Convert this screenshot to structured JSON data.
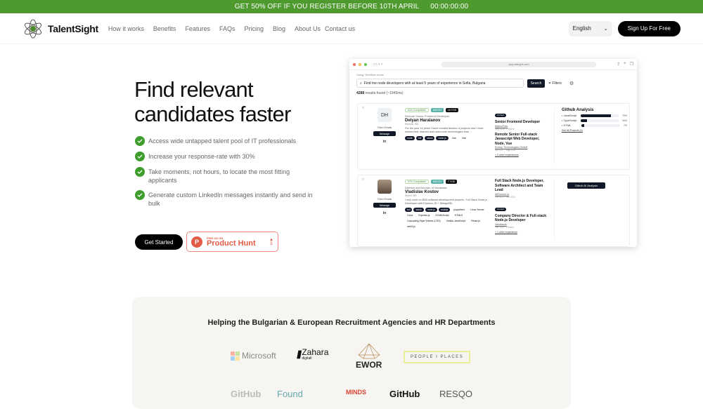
{
  "promo": {
    "text": "GET 50% OFF IF YOU REGISTER BEFORE 10TH APRIL",
    "countdown": "00:00:00:00",
    "color": "#4e9a2f"
  },
  "nav": {
    "brand": "TalentSight",
    "links": [
      "How it works",
      "Benefits",
      "Features",
      "FAQs",
      "Pricing",
      "Blog",
      "About Us",
      "Contact us"
    ],
    "language": "English",
    "signup": "Sign Up For Free"
  },
  "hero": {
    "title_line1": "Find relevant",
    "title_line2": "candidates faster",
    "features": [
      "Access wide untapped talent pool of IT professionals",
      "Increase your response-rate with 30%",
      "Take moments, not hours, to locate the most fitting applicants",
      "Generate custom LinkedIn messages instantly and send in bulk"
    ],
    "cta": "Get Started",
    "product_hunt": {
      "small": "FIND US ON",
      "big": "Product Hunt",
      "votes": "5"
    }
  },
  "browser": {
    "url": "app.talsight.com",
    "mode": "Using: Nextflow mode",
    "query": "Find me node developers with at least 5 years of experience in Sofia, Bulgaria",
    "search_btn": "Search",
    "filters": "Filters",
    "results_count": "4288",
    "results_text": "results found (~1945ms)",
    "candidates": [
      {
        "initials": "DH",
        "fetch": "Fetch Emails",
        "message": "Message",
        "compat": "81% Compatible",
        "match": "MATCH",
        "yoe": "16 YOE",
        "role": "Remote Senior Frontend Developer",
        "name": "Delyan Haralanov",
        "location": "Remote, BG",
        "bio": "For the past 14 years I have created dozens of projects and I have researched, learned and used more technologies than ...",
        "tags_dark": [
          "node",
          "full",
          "stack",
          "node.js"
        ],
        "tags_light": [
          "Vue",
          "Vite"
        ],
        "experience": [
          {
            "current": "Current",
            "title": "Senior Frontend Developer",
            "company": "MamoPoto",
            "dates": "Sep 2019 - Present"
          },
          {
            "current": "",
            "title": "Remote Senior Full-stack Javascript Web Developer, Node, Vue",
            "company": "Entrop Technologies GmbH",
            "dates": "Apr 2017 - Aug 2019"
          }
        ],
        "more": "+ 3 other experiences",
        "github": {
          "title": "Github Analysis",
          "langs": [
            {
              "name": "JavaScript",
              "pct": 79,
              "label": "79%"
            },
            {
              "name": "TypeScript",
              "pct": 16,
              "label": "16%"
            },
            {
              "name": "HTML",
              "pct": 7,
              "label": "7%"
            }
          ],
          "link": "See All Projects (4)"
        }
      },
      {
        "initials": "",
        "fetch": "Fetch Emails",
        "message": "Message",
        "compat": "57% Compatible",
        "match": "MATCH",
        "yoe": "7 YOE",
        "role": "Director and founder of Vavakada",
        "name": "Vladislav Kostov",
        "location": "Sliven, BG",
        "bio": "I only work on B2B software development projects. Full Stack Node.js Developer with Express.JS + MongoDB...",
        "tags_dark": [
          "full",
          "stack",
          "node.js",
          "nodejs"
        ],
        "tags_light": [
          "puppeteer",
          "Linux Server",
          "Linux",
          "Express.js",
          "ECMAScript",
          "HTML5",
          "Cascading Style Sheets (CSS)",
          "Vanilla JavaScript",
          "React.js",
          "web3.js"
        ],
        "experience": [
          {
            "current": "",
            "title": "Full Stack Node.js Developer, Software Architect and Team Lead",
            "company": "AllSource.io",
            "dates": "Oct 2021 - Jun 2023"
          },
          {
            "current": "Current",
            "title": "Company Director & Full-stack Node.js Developer",
            "company": "Vavakada",
            "dates": "Jun 2021 - Present"
          }
        ],
        "more": "+ 1 other experience",
        "github_ai": "Github AI Analysis"
      }
    ]
  },
  "clients": {
    "title": "Helping the Bulgarian & European Recruitment Agencies and HR Departments",
    "logos": [
      "Microsoft",
      "Zahara",
      "digitall",
      "EWOR",
      "PEOPLE I PLACES",
      "GitHub",
      "Found",
      "MINDS",
      "GitHub",
      "RESQO"
    ]
  }
}
